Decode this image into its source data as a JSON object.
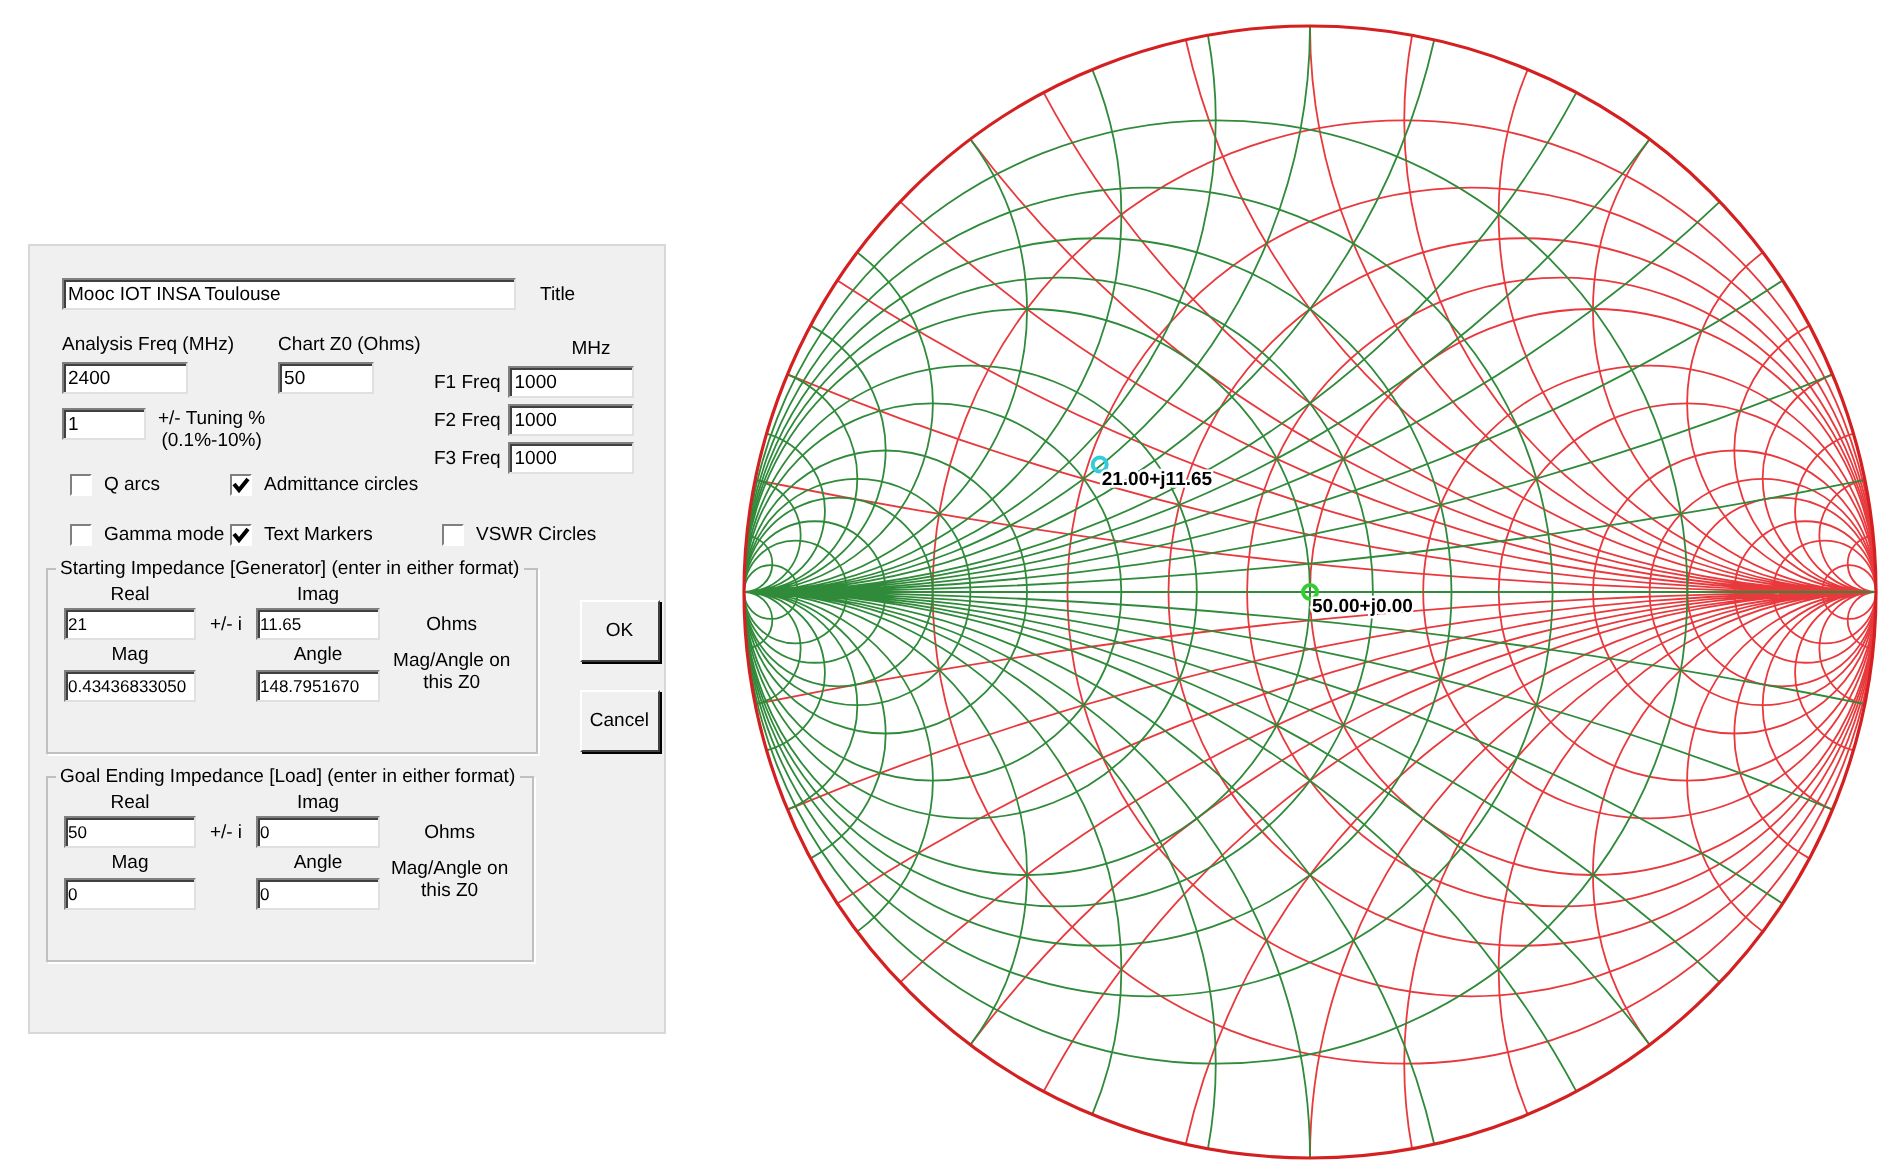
{
  "dialog": {
    "title_field": {
      "value": "Mooc IOT INSA Toulouse",
      "label": "Title"
    },
    "analysis_freq": {
      "label": "Analysis Freq (MHz)",
      "value": "2400"
    },
    "chart_z0": {
      "label": "Chart Z0 (Ohms)",
      "value": "50"
    },
    "tuning": {
      "value": "1",
      "label": "+/- Tuning %",
      "hint": "(0.1%-10%)"
    },
    "freq_unit": "MHz",
    "freqs": [
      {
        "label": "F1 Freq",
        "value": "1000"
      },
      {
        "label": "F2 Freq",
        "value": "1000"
      },
      {
        "label": "F3 Freq",
        "value": "1000"
      }
    ],
    "checkboxes": [
      {
        "label": "Q arcs",
        "checked": false
      },
      {
        "label": "Admittance circles",
        "checked": true
      },
      {
        "label": "Gamma mode",
        "checked": false
      },
      {
        "label": "Text Markers",
        "checked": true
      },
      {
        "label": "VSWR Circles",
        "checked": false
      }
    ],
    "impedances": [
      {
        "legend": "Starting Impedance [Generator] (enter in either format)",
        "real_label": "Real",
        "real": "21",
        "separator": "+/- i",
        "imag_label": "Imag",
        "imag": "11.65",
        "unit": "Ohms",
        "mag_label": "Mag",
        "mag": "0.43436833050",
        "angle_label": "Angle",
        "angle": "148.7951670",
        "note": "Mag/Angle on this Z0"
      },
      {
        "legend": "Goal Ending Impedance [Load] (enter in either format)",
        "real_label": "Real",
        "real": "50",
        "separator": "+/- i",
        "imag_label": "Imag",
        "imag": "0",
        "unit": "Ohms",
        "mag_label": "Mag",
        "mag": "0",
        "angle_label": "Angle",
        "angle": "0",
        "note": "Mag/Angle on this Z0"
      }
    ],
    "buttons": [
      {
        "label": "OK"
      },
      {
        "label": "Cancel"
      }
    ]
  },
  "smith_chart": {
    "markers": [
      {
        "label": "21.00+j11.65",
        "color": "#33ccdd"
      },
      {
        "label": "50.00+j0.00",
        "color": "#33cc33"
      }
    ]
  }
}
